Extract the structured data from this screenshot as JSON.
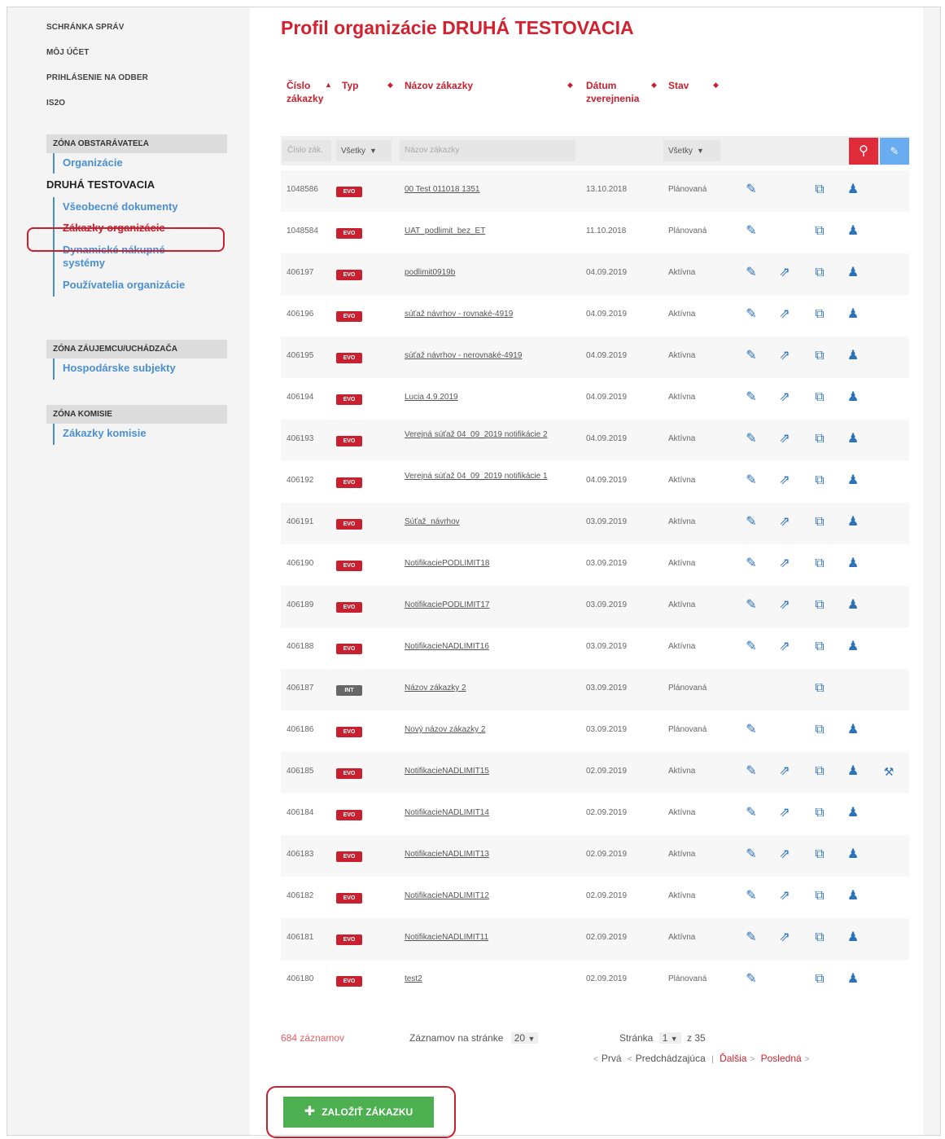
{
  "sidebar": {
    "top_links": [
      "SCHRÁNKA SPRÁV",
      "MÔJ ÚČET",
      "PRIHLÁSENIE NA ODBER",
      "IS2O"
    ],
    "zones": [
      {
        "header": "ZÓNA OBSTARÁVATEĽA",
        "link_organizacie": "Organizácie",
        "org_name": "DRUHÁ TESTOVACIA",
        "items": [
          "Všeobecné dokumenty",
          "Zákazky organizácie",
          "Dynamické nákupné systémy",
          "Používatelia organizácie"
        ],
        "active_index": 1
      },
      {
        "header": "ZÓNA ZÁUJEMCU/UCHÁDZAČA",
        "items": [
          "Hospodárske subjekty"
        ]
      },
      {
        "header": "ZÓNA KOMISIE",
        "items": [
          "Zákazky komisie"
        ]
      }
    ]
  },
  "main": {
    "title": "Profil organizácie DRUHÁ TESTOVACIA",
    "columns": {
      "num": "Číslo zákazky",
      "type": "Typ",
      "name": "Názov zákazky",
      "date": "Dátum zverejnenia",
      "state": "Stav"
    },
    "filters": {
      "num_placeholder": "Číslo zák.",
      "type_value": "Všetky",
      "name_placeholder": "Názov zákazky",
      "state_value": "Všetky"
    },
    "colors": {
      "accent": "#d0222f",
      "link": "#4a8fd0",
      "icon": "#2e72b8",
      "create": "#4caf50"
    },
    "rows": [
      {
        "num": "1048586",
        "type": "EVO",
        "name": "00 Test 011018 1351",
        "date": "13.10.2018",
        "state": "Plánovaná",
        "icons": [
          "edit",
          "",
          "copy",
          "users",
          ""
        ]
      },
      {
        "num": "1048584",
        "type": "EVO",
        "name": "UAT_podlimit_bez_ET",
        "date": "11.10.2018",
        "state": "Plánovaná",
        "icons": [
          "edit",
          "",
          "copy",
          "users",
          ""
        ]
      },
      {
        "num": "406197",
        "type": "EVO",
        "name": "podlimit0919b",
        "date": "04.09.2019",
        "state": "Aktívna",
        "icons": [
          "edit",
          "open",
          "copy",
          "users",
          ""
        ]
      },
      {
        "num": "406196",
        "type": "EVO",
        "name": "súťaž návrhov - rovnaké-4919",
        "date": "04.09.2019",
        "state": "Aktívna",
        "icons": [
          "edit",
          "open",
          "copy",
          "users",
          ""
        ]
      },
      {
        "num": "406195",
        "type": "EVO",
        "name": "súťaž návrhov - nerovnaké-4919",
        "date": "04.09.2019",
        "state": "Aktívna",
        "icons": [
          "edit",
          "open",
          "copy",
          "users",
          ""
        ]
      },
      {
        "num": "406194",
        "type": "EVO",
        "name": "Lucia 4.9.2019",
        "date": "04.09.2019",
        "state": "Aktívna",
        "icons": [
          "edit",
          "open",
          "copy",
          "users",
          ""
        ]
      },
      {
        "num": "406193",
        "type": "EVO",
        "name": "Verejná súťaž 04_09_2019 notifikácie 2",
        "date": "04.09.2019",
        "state": "Aktívna",
        "icons": [
          "edit",
          "open",
          "copy",
          "users",
          ""
        ]
      },
      {
        "num": "406192",
        "type": "EVO",
        "name": "Verejná súťaž 04_09_2019 notifikácie 1",
        "date": "04.09.2019",
        "state": "Aktívna",
        "icons": [
          "edit",
          "open",
          "copy",
          "users",
          ""
        ]
      },
      {
        "num": "406191",
        "type": "EVO",
        "name": "Súťaž_návrhov",
        "date": "03.09.2019",
        "state": "Aktívna",
        "icons": [
          "edit",
          "open",
          "copy",
          "users",
          ""
        ]
      },
      {
        "num": "406190",
        "type": "EVO",
        "name": "NotifikaciePODLIMIT18",
        "date": "03.09.2019",
        "state": "Aktívna",
        "icons": [
          "edit",
          "open",
          "copy",
          "users",
          ""
        ]
      },
      {
        "num": "406189",
        "type": "EVO",
        "name": "NotifikaciePODLIMIT17",
        "date": "03.09.2019",
        "state": "Aktívna",
        "icons": [
          "edit",
          "open",
          "copy",
          "users",
          ""
        ]
      },
      {
        "num": "406188",
        "type": "EVO",
        "name": "NotifikacieNADLIMIT16",
        "date": "03.09.2019",
        "state": "Aktívna",
        "icons": [
          "edit",
          "open",
          "copy",
          "users",
          ""
        ]
      },
      {
        "num": "406187",
        "type": "INT",
        "name": "Názov zákazky 2",
        "date": "03.09.2019",
        "state": "Plánovaná",
        "icons": [
          "",
          "",
          "copy",
          "",
          ""
        ]
      },
      {
        "num": "406186",
        "type": "EVO",
        "name": "Nový názov zákazky 2",
        "date": "03.09.2019",
        "state": "Plánovaná",
        "icons": [
          "edit",
          "",
          "copy",
          "users",
          ""
        ]
      },
      {
        "num": "406185",
        "type": "EVO",
        "name": "NotifikacieNADLIMIT15",
        "date": "02.09.2019",
        "state": "Aktívna",
        "icons": [
          "edit",
          "open",
          "copy",
          "users",
          "gavel"
        ]
      },
      {
        "num": "406184",
        "type": "EVO",
        "name": "NotifikacieNADLIMIT14",
        "date": "02.09.2019",
        "state": "Aktívna",
        "icons": [
          "edit",
          "open",
          "copy",
          "users",
          ""
        ]
      },
      {
        "num": "406183",
        "type": "EVO",
        "name": "NotifikacieNADLIMIT13",
        "date": "02.09.2019",
        "state": "Aktívna",
        "icons": [
          "edit",
          "open",
          "copy",
          "users",
          ""
        ]
      },
      {
        "num": "406182",
        "type": "EVO",
        "name": "NotifikacieNADLIMIT12",
        "date": "02.09.2019",
        "state": "Aktívna",
        "icons": [
          "edit",
          "open",
          "copy",
          "users",
          ""
        ]
      },
      {
        "num": "406181",
        "type": "EVO",
        "name": "NotifikacieNADLIMIT11",
        "date": "02.09.2019",
        "state": "Aktívna",
        "icons": [
          "edit",
          "open",
          "copy",
          "users",
          ""
        ]
      },
      {
        "num": "406180",
        "type": "EVO",
        "name": "test2",
        "date": "02.09.2019",
        "state": "Plánovaná",
        "icons": [
          "edit",
          "",
          "copy",
          "users",
          ""
        ]
      }
    ],
    "footer": {
      "records": "684 záznamov",
      "per_page_label": "Záznamov na stránke",
      "per_page_value": "20",
      "page_label": "Stránka",
      "page_value": "1",
      "page_total": "z 35",
      "first": "Prvá",
      "prev": "Predchádzajúca",
      "sep": "|",
      "next": "Ďalšia",
      "last": "Posledná"
    },
    "create_button": "ZALOŽIŤ ZÁKAZKU"
  }
}
